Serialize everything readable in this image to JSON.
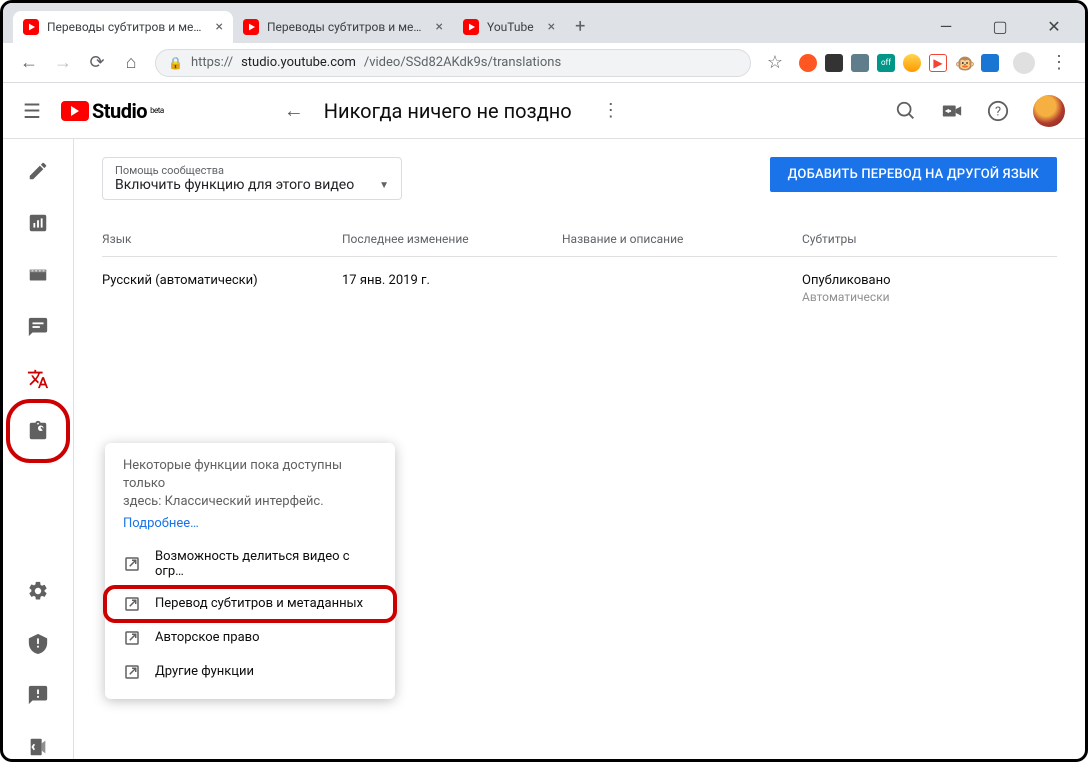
{
  "window": {
    "minimize": "—",
    "maximize": "▢",
    "close": "✕"
  },
  "tabs": [
    {
      "title": "Переводы субтитров и метадан",
      "active": true
    },
    {
      "title": "Переводы субтитров и метадан",
      "active": false
    },
    {
      "title": "YouTube",
      "active": false
    }
  ],
  "newtab": "+",
  "address": {
    "scheme": "https://",
    "host": "studio.youtube.com",
    "path": "/video/SSd82AKdk9s/translations"
  },
  "app": {
    "logo_text": "Studio",
    "logo_beta": "beta",
    "page_title": "Никогда ничего не поздно"
  },
  "community": {
    "label": "Помощь сообщества",
    "value": "Включить функцию для этого видео"
  },
  "add_translation_button": "ДОБАВИТЬ ПЕРЕВОД НА ДРУГОЙ ЯЗЫК",
  "table": {
    "headers": {
      "language": "Язык",
      "modified": "Последнее изменение",
      "title_desc": "Название и описание",
      "subtitles": "Субтитры"
    },
    "rows": [
      {
        "language": "Русский (автоматически)",
        "modified": "17 янв. 2019 г.",
        "title_desc": "",
        "subtitles_status": "Опубликовано",
        "subtitles_note": "Автоматически"
      }
    ]
  },
  "popup": {
    "msg_line1": "Некоторые функции пока доступны только",
    "msg_line2": "здесь: Классический интерфейс.",
    "learn_more": "Подробнее…",
    "items": [
      "Возможность делиться видео с огр…",
      "Перевод субтитров и метаданных",
      "Авторское право",
      "Другие функции"
    ]
  }
}
